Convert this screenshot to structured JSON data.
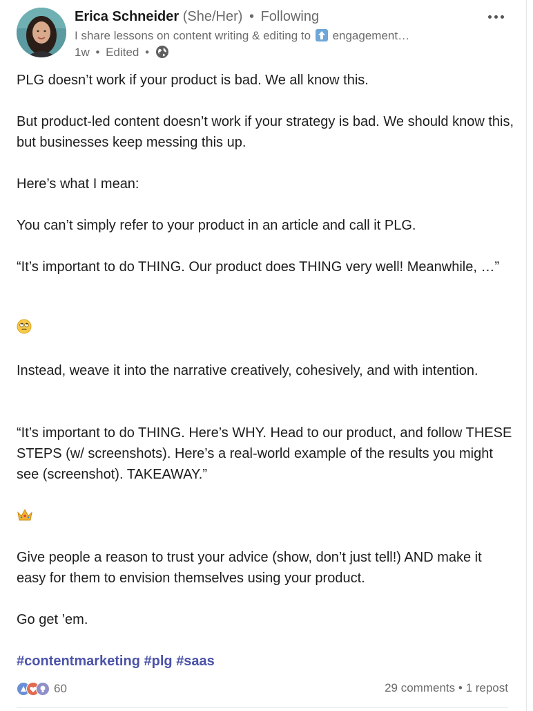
{
  "post": {
    "author": {
      "name": "Erica Schneider",
      "pronouns": "(She/Her)",
      "follow_status": "Following",
      "headline_before": "I share lessons on content writing & editing to",
      "headline_after": "engagement…",
      "time_ago": "1w",
      "edited": "Edited"
    },
    "body": [
      "PLG doesn’t work if your product is bad. We all know this.",
      "But product-led content doesn’t work if your strategy is bad. We should know this, but businesses keep messing this up.",
      "Here’s what I mean:",
      "You can’t simply refer to your product in an article and call it PLG.",
      "“It’s important to do THING. Our product does THING very well! Meanwhile, …”",
      "🙄",
      "Instead, weave it into the narrative creatively, cohesively, and with intention.",
      "“It’s important to do THING. Here’s WHY. Head to our product, and follow THESE STEPS (w/ screenshots). Here’s a real-world example of the results you might see (screenshot). TAKEAWAY.”",
      "👑",
      "Give people a reason to trust your advice (show, don’t just tell!) AND make it easy for them to envision themselves using your product.",
      "Go get ’em."
    ],
    "hashtags": [
      "#contentmarketing",
      "#plg",
      "#saas"
    ],
    "reaction_count": "60",
    "comments": "29 comments",
    "reposts": "1 repost",
    "reaction_icons": [
      "celebrate-icon",
      "love-icon",
      "insightful-icon"
    ],
    "colors": {
      "hashtag": "#4b53a8",
      "muted": "#6b6b6b",
      "text": "#1d1d1d"
    }
  }
}
